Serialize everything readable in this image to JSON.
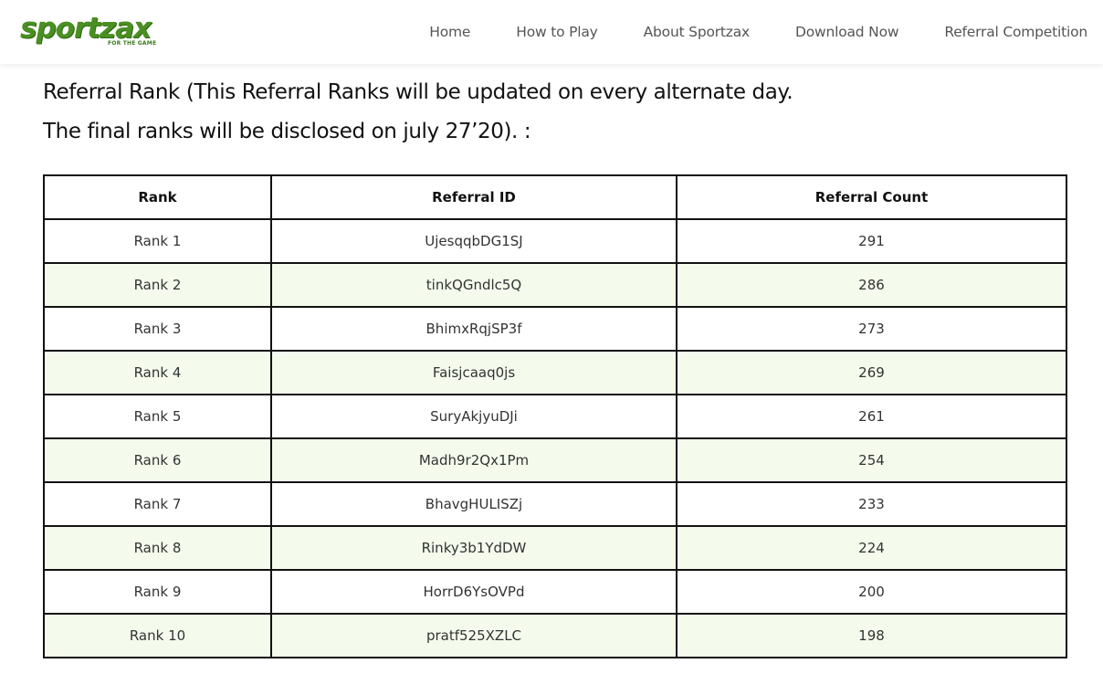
{
  "brand": {
    "logo_text": "sportzax",
    "tagline": "FOR THE GAME",
    "color": "#4a8f22"
  },
  "nav": {
    "items": [
      {
        "label": "Home"
      },
      {
        "label": "How to Play"
      },
      {
        "label": "About Sportzax"
      },
      {
        "label": "Download Now"
      },
      {
        "label": "Referral Competition"
      }
    ]
  },
  "main": {
    "heading_line1": "Referral Rank (This Referral Ranks will be updated on every alternate day.",
    "heading_line2": "The final ranks will be disclosed on july 27’20). :"
  },
  "table": {
    "headers": [
      "Rank",
      "Referral ID",
      "Referral Count"
    ],
    "rows": [
      {
        "rank": "Rank 1",
        "id": "UjesqqbDG1SJ",
        "count": "291"
      },
      {
        "rank": "Rank 2",
        "id": "tinkQGndlc5Q",
        "count": "286"
      },
      {
        "rank": "Rank 3",
        "id": "BhimxRqjSP3f",
        "count": "273"
      },
      {
        "rank": "Rank 4",
        "id": "Faisjcaaq0js",
        "count": "269"
      },
      {
        "rank": "Rank 5",
        "id": "SuryAkjyuDJi",
        "count": "261"
      },
      {
        "rank": "Rank 6",
        "id": "Madh9r2Qx1Pm",
        "count": "254"
      },
      {
        "rank": "Rank 7",
        "id": "BhavgHULISZj",
        "count": "233"
      },
      {
        "rank": "Rank 8",
        "id": "Rinky3b1YdDW",
        "count": "224"
      },
      {
        "rank": "Rank 9",
        "id": "HorrD6YsOVPd",
        "count": "200"
      },
      {
        "rank": "Rank 10",
        "id": "pratf525XZLC",
        "count": "198"
      }
    ],
    "alt_row_color": "#f4fbed",
    "border_color": "#111111"
  }
}
